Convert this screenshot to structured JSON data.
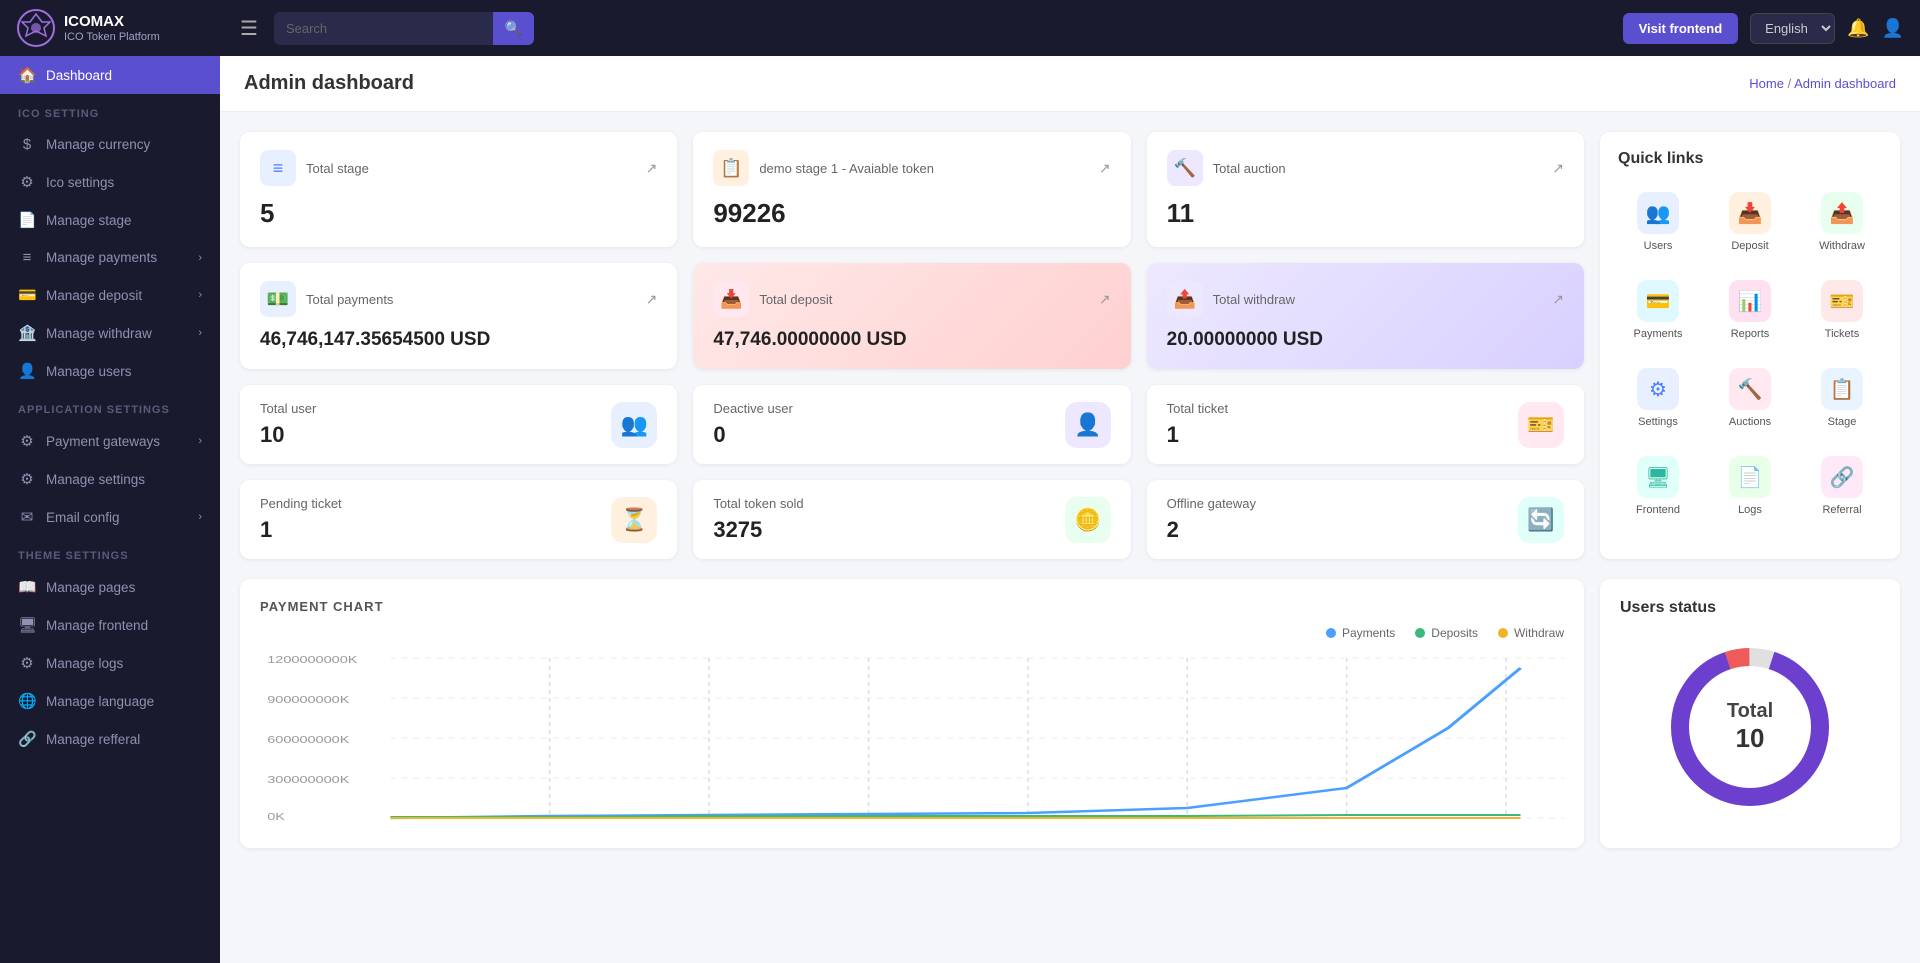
{
  "app": {
    "name": "ICOMAX",
    "subtitle": "ICO Token Platform",
    "visit_frontend_label": "Visit frontend",
    "language": "English"
  },
  "navbar": {
    "search_placeholder": "Search",
    "hamburger_label": "☰"
  },
  "sidebar": {
    "dashboard_label": "Dashboard",
    "sections": [
      {
        "title": "ICO SETTING",
        "items": [
          {
            "label": "Manage currency",
            "icon": "$",
            "has_arrow": false
          },
          {
            "label": "Ico settings",
            "icon": "⚙",
            "has_arrow": false
          },
          {
            "label": "Manage stage",
            "icon": "📄",
            "has_arrow": false
          },
          {
            "label": "Manage payments",
            "icon": "≡",
            "has_arrow": true
          },
          {
            "label": "Manage deposit",
            "icon": "💳",
            "has_arrow": true
          },
          {
            "label": "Manage withdraw",
            "icon": "🏦",
            "has_arrow": true
          },
          {
            "label": "Manage users",
            "icon": "👤",
            "has_arrow": false
          }
        ]
      },
      {
        "title": "APPLICATION SETTINGS",
        "items": [
          {
            "label": "Payment gateways",
            "icon": "⚙",
            "has_arrow": true
          },
          {
            "label": "Manage settings",
            "icon": "⚙",
            "has_arrow": false
          },
          {
            "label": "Email config",
            "icon": "✉",
            "has_arrow": true
          }
        ]
      },
      {
        "title": "THEME SETTINGS",
        "items": [
          {
            "label": "Manage pages",
            "icon": "📖",
            "has_arrow": false
          },
          {
            "label": "Manage frontend",
            "icon": "🖥",
            "has_arrow": false
          },
          {
            "label": "Manage logs",
            "icon": "⚙",
            "has_arrow": false
          },
          {
            "label": "Manage language",
            "icon": "🌐",
            "has_arrow": false
          },
          {
            "label": "Manage refferal",
            "icon": "🔗",
            "has_arrow": false
          }
        ]
      }
    ]
  },
  "main": {
    "title": "Admin dashboard",
    "breadcrumb_home": "Home",
    "breadcrumb_current": "Admin dashboard"
  },
  "stats_row1": [
    {
      "label": "Total stage",
      "value": "5",
      "icon": "≡",
      "icon_bg": "bg-blue-light",
      "icon_color": "text-blue"
    },
    {
      "label": "demo stage 1 - Avaiable token",
      "value": "99226",
      "icon": "📋",
      "icon_bg": "bg-orange-light",
      "icon_color": "text-orange"
    },
    {
      "label": "Total auction",
      "value": "11",
      "icon": "🔨",
      "icon_bg": "bg-purple-light",
      "icon_color": "text-purple"
    }
  ],
  "stats_row2": [
    {
      "label": "Total payments",
      "value": "46,746,147.35654500 USD",
      "icon": "💵",
      "icon_bg": "bg-blue-light",
      "icon_color": "text-blue",
      "card_type": "normal"
    },
    {
      "label": "Total deposit",
      "value": "47,746.00000000 USD",
      "icon": "📥",
      "icon_bg": "bg-pink-light",
      "icon_color": "text-pink",
      "card_type": "pink"
    },
    {
      "label": "Total withdraw",
      "value": "20.00000000 USD",
      "icon": "📤",
      "icon_bg": "bg-purple-light",
      "icon_color": "text-purple",
      "card_type": "purple"
    }
  ],
  "stats_sm_row1": [
    {
      "label": "Total user",
      "value": "10",
      "icon": "👥",
      "icon_bg": "bg-blue-light",
      "icon_color": "text-blue"
    },
    {
      "label": "Deactive user",
      "value": "0",
      "icon": "👤",
      "icon_bg": "bg-purple-light",
      "icon_color": "text-purple"
    },
    {
      "label": "Total ticket",
      "value": "1",
      "icon": "🎫",
      "icon_bg": "bg-pink-light",
      "icon_color": "text-pink"
    }
  ],
  "stats_sm_row2": [
    {
      "label": "Pending ticket",
      "value": "1",
      "icon": "⏳",
      "icon_bg": "bg-orange-light",
      "icon_color": "text-orange"
    },
    {
      "label": "Total token sold",
      "value": "3275",
      "icon": "🪙",
      "icon_bg": "bg-green-light",
      "icon_color": "text-green"
    },
    {
      "label": "Offline gateway",
      "value": "2",
      "icon": "🔄",
      "icon_bg": "bg-teal-light",
      "icon_color": "text-teal"
    }
  ],
  "quick_links": {
    "title": "Quick links",
    "items": [
      {
        "label": "Users",
        "icon": "👥",
        "bg": "#e8f0ff",
        "color": "#4a7fff"
      },
      {
        "label": "Deposit",
        "icon": "📥",
        "bg": "#fff0e0",
        "color": "#ff9a3c"
      },
      {
        "label": "Withdraw",
        "icon": "📤",
        "bg": "#e8fff0",
        "color": "#3cb87a"
      },
      {
        "label": "Payments",
        "icon": "💳",
        "bg": "#e0f8ff",
        "color": "#2cb8d8"
      },
      {
        "label": "Reports",
        "icon": "📊",
        "bg": "#ffe0f0",
        "color": "#ef5a8a"
      },
      {
        "label": "Tickets",
        "icon": "🎫",
        "bg": "#ffe8e8",
        "color": "#ef5a5a"
      },
      {
        "label": "Settings",
        "icon": "⚙",
        "bg": "#e8f0ff",
        "color": "#4a7fff"
      },
      {
        "label": "Auctions",
        "icon": "🔨",
        "bg": "#ffe8f0",
        "color": "#ef5a5a"
      },
      {
        "label": "Stage",
        "icon": "📋",
        "bg": "#e8f4ff",
        "color": "#3a9fff"
      },
      {
        "label": "Frontend",
        "icon": "🖥",
        "bg": "#e0fff8",
        "color": "#2cb8a0"
      },
      {
        "label": "Logs",
        "icon": "📄",
        "bg": "#e8ffe8",
        "color": "#3cb87a"
      },
      {
        "label": "Referral",
        "icon": "🔗",
        "bg": "#ffe8f8",
        "color": "#d85acf"
      }
    ]
  },
  "payment_chart": {
    "title": "PAYMENT CHART",
    "legend": [
      {
        "label": "Payments",
        "color": "#4a9fff"
      },
      {
        "label": "Deposits",
        "color": "#3cb87a"
      },
      {
        "label": "Withdraw",
        "color": "#f0b429"
      }
    ],
    "y_labels": [
      "1200000000K",
      "900000000K",
      "600000000K",
      "300000000K",
      "0K"
    ]
  },
  "users_status": {
    "title": "Users status",
    "total_label": "Total",
    "total_value": "10",
    "segments": [
      {
        "color": "#ef5a5a",
        "percent": 5
      },
      {
        "color": "#6c3fcf",
        "percent": 90
      },
      {
        "color": "#e0e0e0",
        "percent": 5
      }
    ]
  }
}
